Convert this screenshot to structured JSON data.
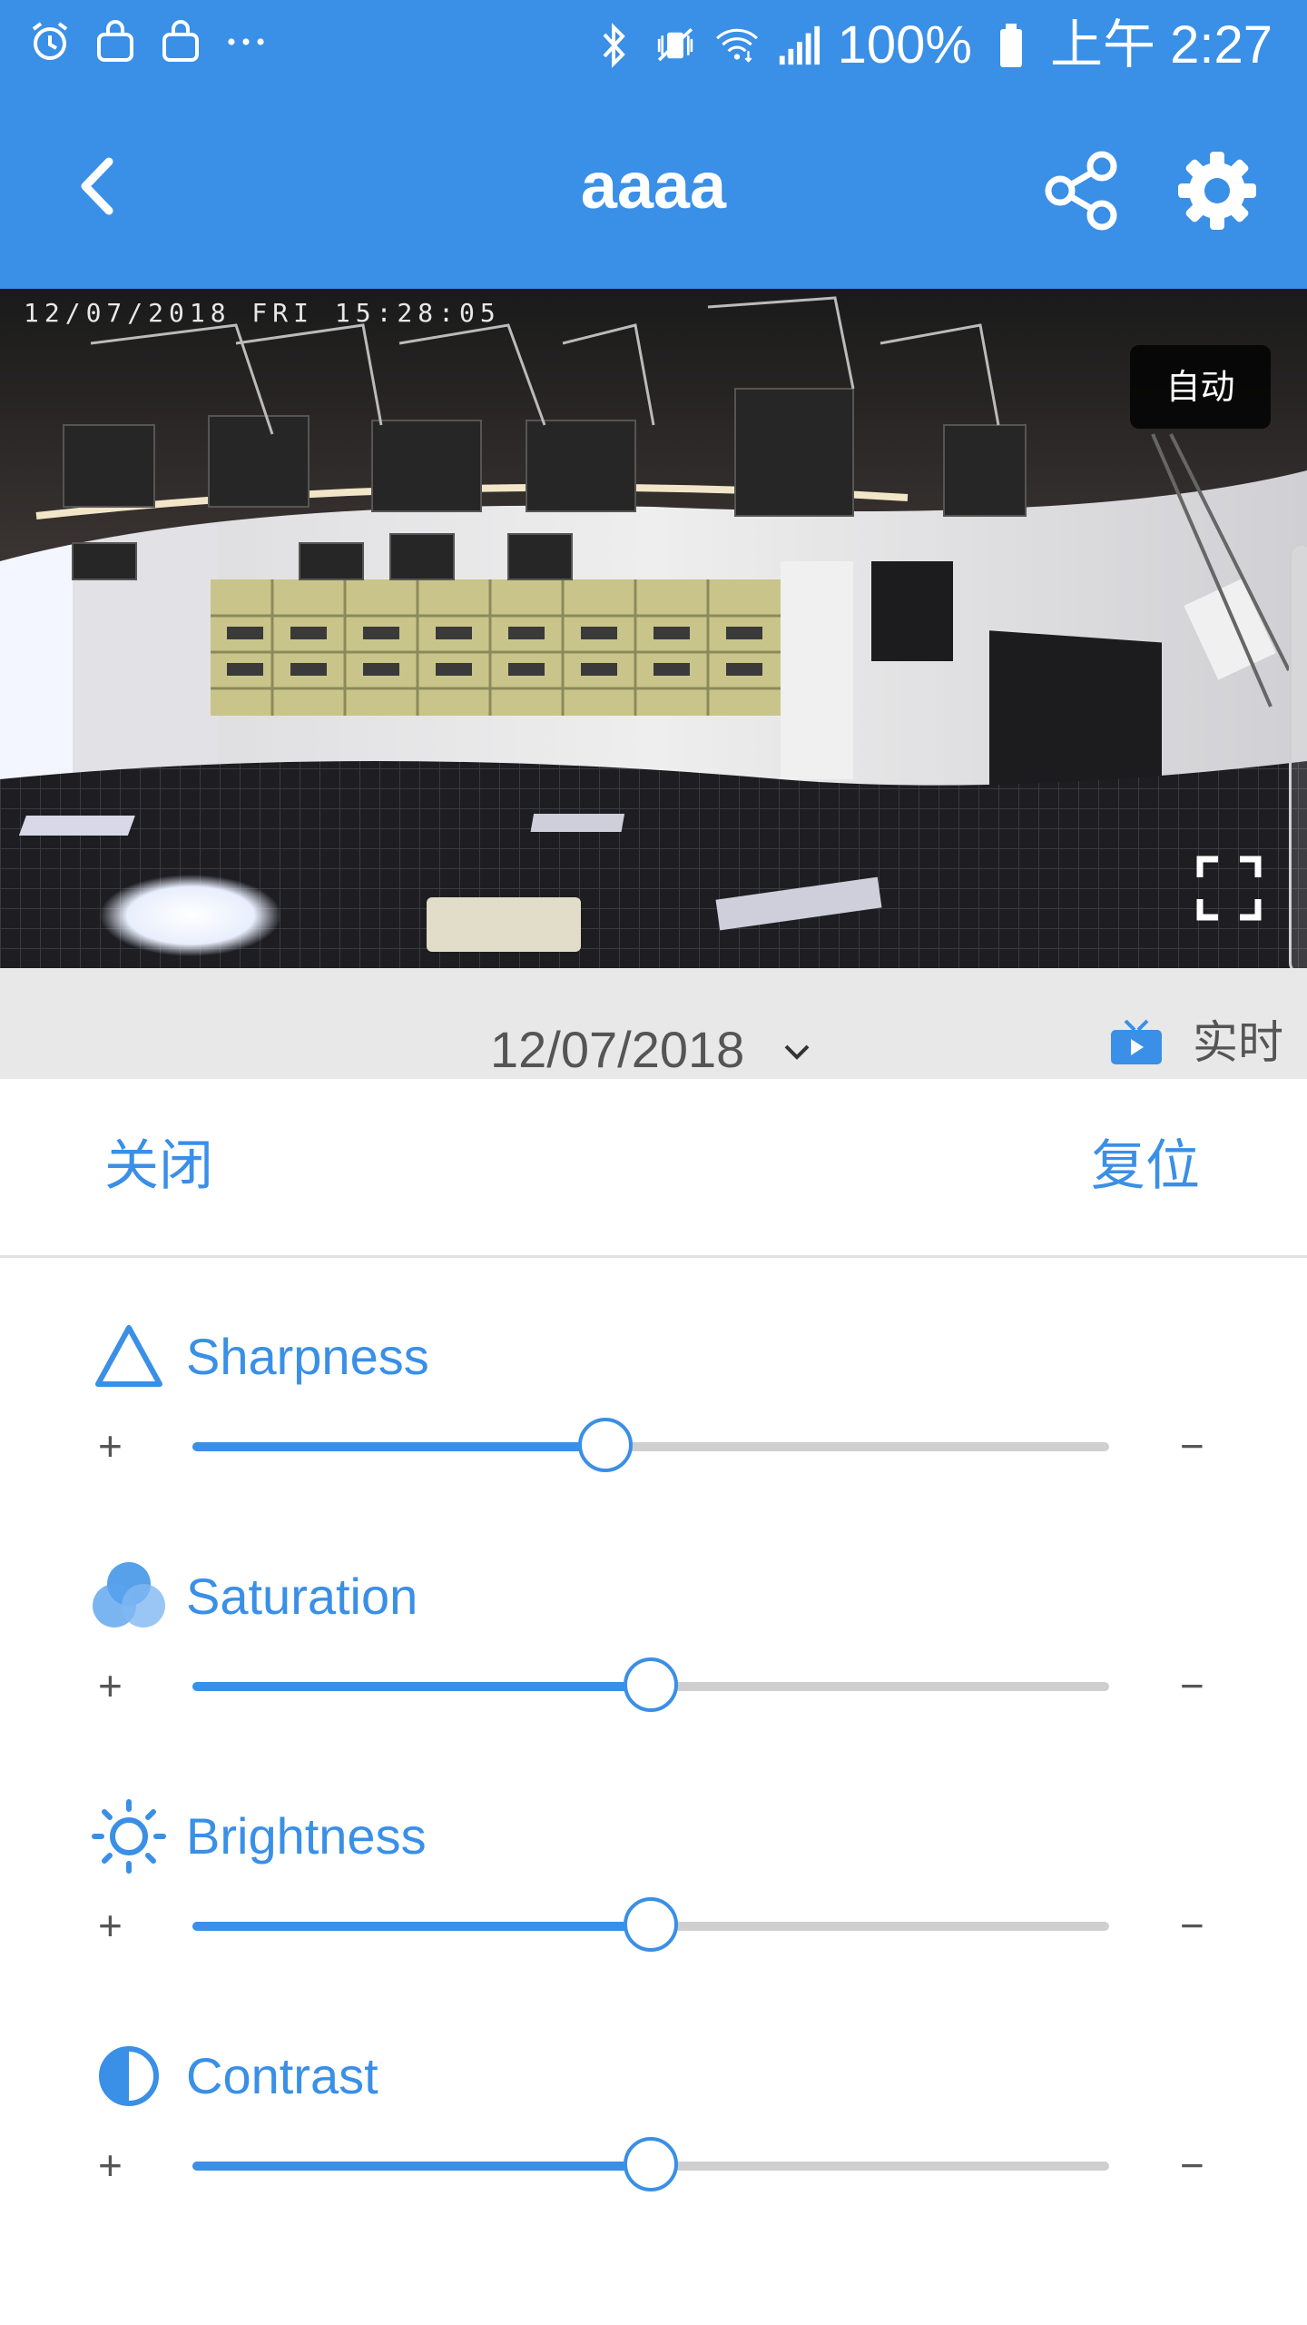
{
  "status_bar": {
    "left_icons": [
      "alarm-icon",
      "shopping-bag-icon",
      "shopping-bag-icon",
      "more-dots-icon"
    ],
    "right_icons": [
      "bluetooth-icon",
      "vibrate-mute-icon",
      "wifi-icon",
      "signal-icon"
    ],
    "battery": "100%",
    "time": "上午 2:27"
  },
  "app_bar": {
    "title": "aaaa",
    "back_icon": "chevron-left-icon",
    "share_icon": "share-icon",
    "settings_icon": "gear-icon"
  },
  "video": {
    "timestamp": "12/07/2018  FRI  15:28:05",
    "quality_badge": "自动",
    "fullscreen_icon": "fullscreen-icon"
  },
  "date_bar": {
    "date": "12/07/2018",
    "live_label": "实时",
    "accent": "#3a8fe6"
  },
  "actions": {
    "close": "关闭",
    "reset": "复位"
  },
  "settings": [
    {
      "label": "Sharpness",
      "icon": "triangle-icon",
      "plus": "+",
      "minus": "−",
      "level": 0.45
    },
    {
      "label": "Saturation",
      "icon": "color-circles-icon",
      "plus": "+",
      "minus": "−",
      "level": 0.5
    },
    {
      "label": "Brightness",
      "icon": "sun-icon",
      "plus": "+",
      "minus": "−",
      "level": 0.5
    },
    {
      "label": "Contrast",
      "icon": "contrast-icon",
      "plus": "+",
      "minus": "−",
      "level": 0.5
    }
  ]
}
